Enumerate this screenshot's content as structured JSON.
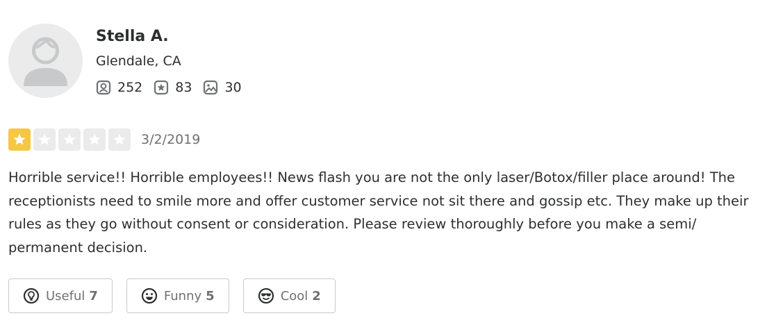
{
  "user": {
    "name": "Stella A.",
    "location": "Glendale, CA",
    "stats": {
      "friends": "252",
      "reviews": "83",
      "photos": "30"
    }
  },
  "review": {
    "rating": 1,
    "rating_max": 5,
    "date": "3/2/2019",
    "text": "Horrible service!! Horrible employees!! News flash you are not the only laser/Botox/filler place around! The receptionists need to smile more and offer customer service not sit there and gossip etc. They make up their rules as they go without consent or consideration. Please review thoroughly before you make a semi/ permanent decision."
  },
  "reactions": {
    "useful": {
      "label": "Useful",
      "count": "7"
    },
    "funny": {
      "label": "Funny",
      "count": "5"
    },
    "cool": {
      "label": "Cool",
      "count": "2"
    }
  },
  "colors": {
    "star_on": "#f6c744",
    "star_off": "#ebebeb"
  }
}
